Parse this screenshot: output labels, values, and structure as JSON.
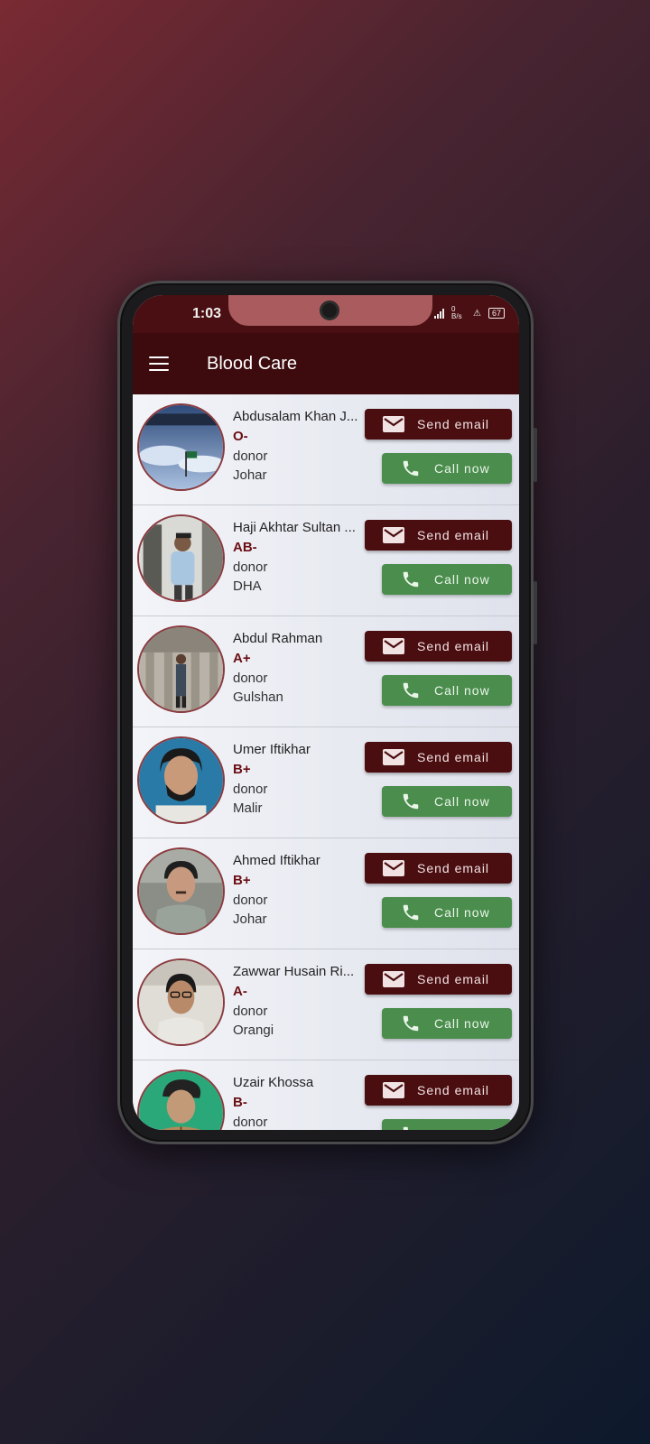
{
  "status": {
    "time": "1:03",
    "net_rate": "0 B/s",
    "battery": "67"
  },
  "appbar": {
    "title": "Blood Care",
    "menu_icon": "hamburger-menu-icon"
  },
  "buttons": {
    "email_label": "Send email",
    "call_label": "Call now"
  },
  "colors": {
    "appbar": "#3d0b0e",
    "email_button": "#4a0d10",
    "call_button": "#4a8d4c",
    "blood_group": "#6a0f14"
  },
  "donors": [
    {
      "name": "Abdusalam Khan J...",
      "blood_group": "O-",
      "role": "donor",
      "area": "Johar"
    },
    {
      "name": "Haji Akhtar Sultan ...",
      "blood_group": "AB-",
      "role": "donor",
      "area": "DHA"
    },
    {
      "name": "Abdul Rahman",
      "blood_group": "A+",
      "role": "donor",
      "area": "Gulshan"
    },
    {
      "name": "Umer Iftikhar",
      "blood_group": "B+",
      "role": "donor",
      "area": "Malir"
    },
    {
      "name": "Ahmed Iftikhar",
      "blood_group": "B+",
      "role": "donor",
      "area": "Johar"
    },
    {
      "name": "Zawwar Husain Ri...",
      "blood_group": "A-",
      "role": "donor",
      "area": "Orangi"
    },
    {
      "name": "Uzair Khossa",
      "blood_group": "B-",
      "role": "donor",
      "area": ""
    }
  ]
}
